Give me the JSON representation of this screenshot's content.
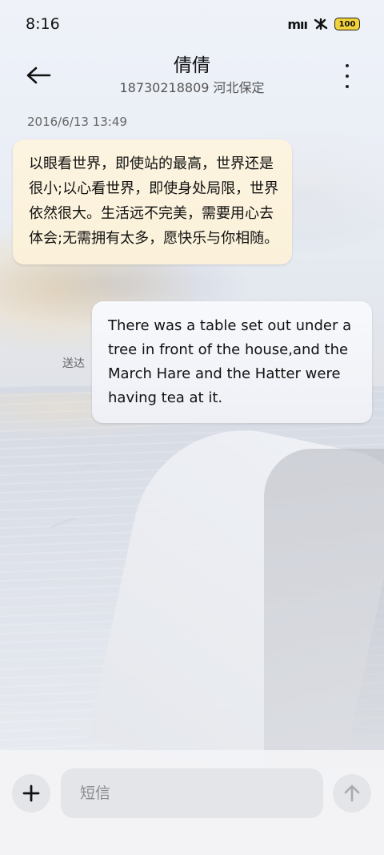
{
  "status_bar": {
    "time": "8:16",
    "signal_label": "mıı",
    "battery_level": "100"
  },
  "header": {
    "contact_name": "倩倩",
    "contact_number_location": "18730218809 河北保定",
    "back_icon": "arrow-left-icon",
    "more_icon": "more-vertical-icon"
  },
  "conversation": {
    "timestamp": "2016/6/13 13:49",
    "messages": [
      {
        "direction": "incoming",
        "text": "以眼看世界，即使站的最高，世界还是很小;以心看世界，即使身处局限，世界依然很大。生活远不完美，需要用心去体会;无需拥有太多，愿快乐与你相随。"
      },
      {
        "direction": "outgoing",
        "text": "There was a table set out under a tree in front of the house,and the March Hare and the Hatter were having tea at it.",
        "status": "送达"
      }
    ]
  },
  "composer": {
    "placeholder": "短信",
    "add_icon": "plus-icon",
    "send_icon": "arrow-up-icon"
  },
  "colors": {
    "incoming_bubble": "#fcf4e0",
    "outgoing_bubble": "#f4f5fa",
    "battery_fill": "#f2d43a"
  }
}
